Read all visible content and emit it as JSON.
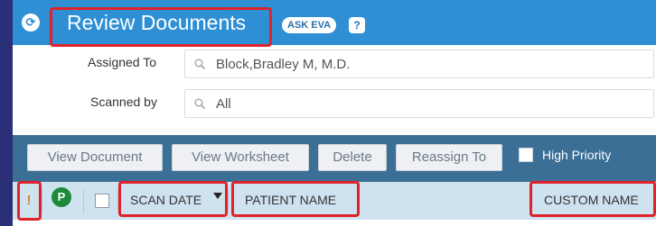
{
  "header": {
    "title": "Review Documents",
    "ask_eva": "ASK EVA",
    "help": "?",
    "app_icon": "document-icon"
  },
  "filters": {
    "assigned_to": {
      "label": "Assigned To",
      "value": "Block,Bradley M, M.D."
    },
    "scanned_by": {
      "label": "Scanned by",
      "value": "All"
    }
  },
  "actions": {
    "view_document": "View Document",
    "view_worksheet": "View Worksheet",
    "delete": "Delete",
    "reassign_to": "Reassign To",
    "high_priority": "High Priority"
  },
  "table": {
    "priority_symbol": "!",
    "p_symbol": "P",
    "columns": {
      "scan_date": "SCAN DATE",
      "patient_name": "PATIENT NAME",
      "custom_name": "CUSTOM NAME"
    }
  },
  "colors": {
    "header_bg": "#2e8fd4",
    "action_bar_bg": "#3b6f96",
    "table_header_bg": "#cfe2f0",
    "highlight": "#e0222b"
  }
}
